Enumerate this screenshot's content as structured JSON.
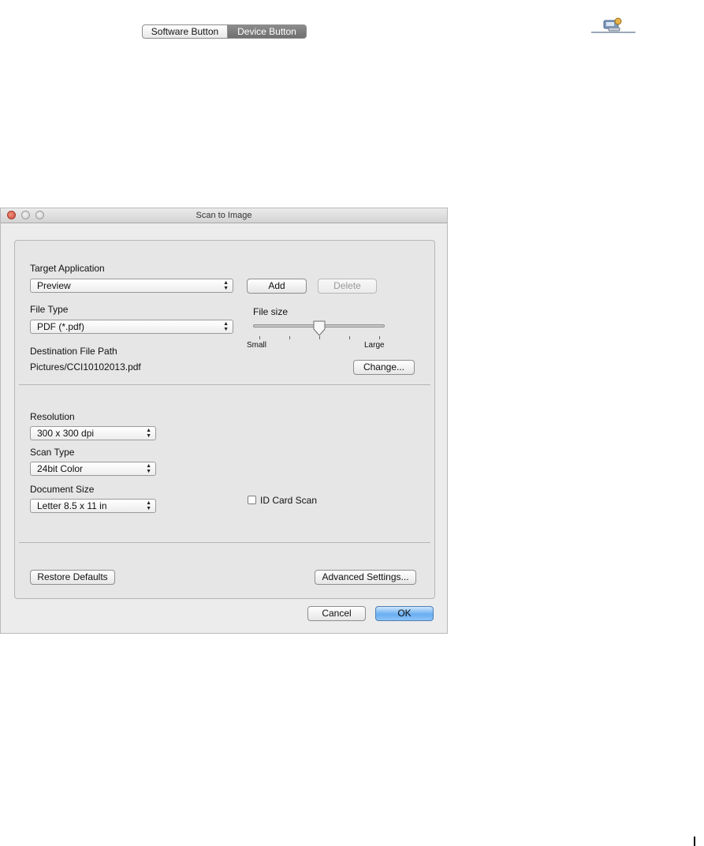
{
  "window": {
    "title": "Scan to Image"
  },
  "tabs": [
    {
      "label": "Software Button",
      "active": false
    },
    {
      "label": "Device Button",
      "active": true
    }
  ],
  "target_application": {
    "label": "Target Application",
    "selected": "Preview",
    "add_label": "Add",
    "delete_label": "Delete"
  },
  "file_type": {
    "label": "File Type",
    "selected": "PDF (*.pdf)"
  },
  "file_size": {
    "label": "File size",
    "min_label": "Small",
    "max_label": "Large",
    "value_fraction": 0.5
  },
  "destination": {
    "label": "Destination File Path",
    "path": "Pictures/CCI10102013.pdf",
    "change_label": "Change..."
  },
  "resolution": {
    "label": "Resolution",
    "selected": "300 x 300 dpi"
  },
  "scan_type": {
    "label": "Scan Type",
    "selected": "24bit Color"
  },
  "document_size": {
    "label": "Document Size",
    "selected": "Letter 8.5 x 11 in"
  },
  "id_card_scan": {
    "label": "ID Card Scan",
    "checked": false
  },
  "footer": {
    "restore_label": "Restore Defaults",
    "advanced_label": "Advanced Settings...",
    "cancel_label": "Cancel",
    "ok_label": "OK"
  },
  "icons": {
    "app": "scanner-app-icon"
  }
}
